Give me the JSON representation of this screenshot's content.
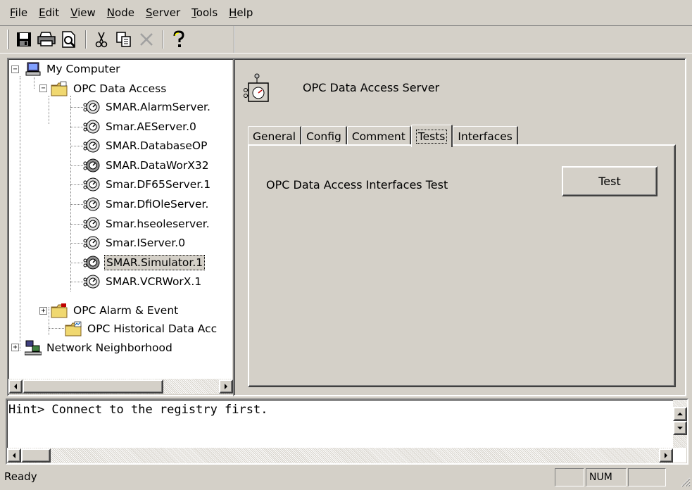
{
  "menu": {
    "items": [
      {
        "label": "File",
        "mnemonic": "F",
        "rest": "ile"
      },
      {
        "label": "Edit",
        "mnemonic": "E",
        "rest": "dit"
      },
      {
        "label": "View",
        "mnemonic": "V",
        "rest": "iew"
      },
      {
        "label": "Node",
        "mnemonic": "N",
        "rest": "ode"
      },
      {
        "label": "Server",
        "mnemonic": "S",
        "rest": "erver"
      },
      {
        "label": "Tools",
        "mnemonic": "T",
        "rest": "ools"
      },
      {
        "label": "Help",
        "mnemonic": "H",
        "rest": "elp"
      }
    ]
  },
  "toolbar": {
    "buttons": [
      "save-icon",
      "print-icon",
      "print-preview-icon",
      "cut-icon",
      "copy-icon",
      "delete-icon",
      "help-icon"
    ]
  },
  "tree": {
    "root": "My Computer",
    "opc_da": "OPC Data Access",
    "servers": [
      "SMAR.AlarmServer.",
      "Smar.AEServer.0",
      "SMAR.DatabaseOP",
      "SMAR.DataWorX32",
      "Smar.DF65Server.1",
      "Smar.DfiOleServer.",
      "Smar.hseoleserver.",
      "Smar.IServer.0",
      "SMAR.Simulator.1",
      "SMAR.VCRWorX.1"
    ],
    "selected_server": "SMAR.Simulator.1",
    "opc_ae": "OPC Alarm & Event",
    "opc_hda": "OPC Historical Data Acc",
    "network": "Network Neighborhood"
  },
  "details": {
    "server_title": "OPC Data Access Server",
    "tabs": [
      "General",
      "Config",
      "Comment",
      "Tests",
      "Interfaces"
    ],
    "active_tab": "Tests",
    "test_label": "OPC Data Access Interfaces Test",
    "test_button": "Test"
  },
  "hint": {
    "text": "Hint> Connect to the registry first."
  },
  "status": {
    "text": "Ready",
    "num": "NUM"
  }
}
